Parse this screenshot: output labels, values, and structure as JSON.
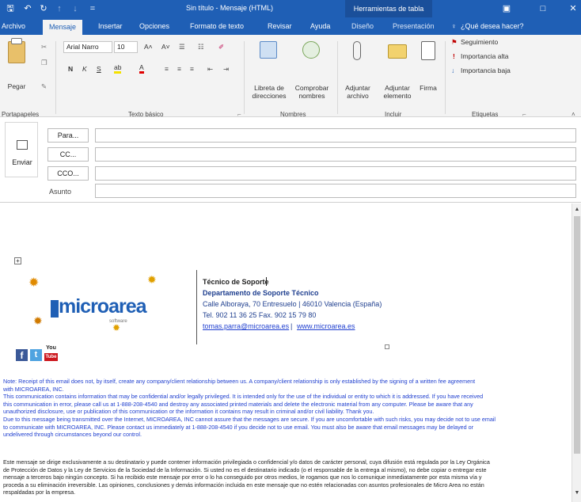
{
  "window": {
    "title": "Sin título - Mensaje (HTML)",
    "tools_context": "Herramientas de tabla",
    "quick_access": {
      "save": "🖫",
      "undo": "↶",
      "redo": "↻",
      "up": "↑",
      "down": "↓",
      "more": "="
    },
    "controls": {
      "ribbon_options": "▣",
      "restore": "□",
      "close": "✕"
    }
  },
  "tabs": [
    "Archivo",
    "Mensaje",
    "Insertar",
    "Opciones",
    "Formato de texto",
    "Revisar",
    "Ayuda",
    "Diseño",
    "Presentación"
  ],
  "tell_me": "¿Qué desea hacer?",
  "ribbon": {
    "clipboard": {
      "paste": "Pegar",
      "label": "Portapapeles"
    },
    "basic_text": {
      "font": "Arial Narro",
      "size": "10",
      "bold": "N",
      "italic": "K",
      "underline": "S",
      "label": "Texto básico"
    },
    "names": {
      "address_book_1": "Libreta de",
      "address_book_2": "direcciones",
      "check_1": "Comprobar",
      "check_2": "nombres",
      "label": "Nombres"
    },
    "include": {
      "attach_file_1": "Adjuntar",
      "attach_file_2": "archivo",
      "attach_item_1": "Adjuntar",
      "attach_item_2": "elemento",
      "signature": "Firma",
      "label": "Incluir"
    },
    "tags": {
      "follow_up": "Seguimiento",
      "high": "Importancia alta",
      "low": "Importancia baja",
      "label": "Etiquetas"
    }
  },
  "compose": {
    "send": "Enviar",
    "to": "Para...",
    "cc": "CC...",
    "bcc": "CCO...",
    "subject": "Asunto"
  },
  "signature": {
    "logo_text": "microarea",
    "logo_sub": "software",
    "title": "Técnico de Soporte",
    "department": "Departamento de Soporte Técnico",
    "address": "Calle Alboraya, 70 Entresuelo | 46010 Valencia (España)",
    "phone": "Tel. 902 11 36 25 Fax. 902 15 79 80",
    "email": "tomas.parra@microarea.es",
    "separator": "|",
    "web": "www.microarea.es",
    "social": {
      "facebook": "f",
      "twitter": "t",
      "youtube_top": "You",
      "youtube_bottom": "Tube"
    }
  },
  "disclaimer_en": [
    "Note: Receipt of this email does not, by itself, create any company/client relationship between us.  A company/client relationship is only established by the signing of a written fee agreement",
    "with MICROAREA, INC.",
    "This communication contains information that may be confidential and/or legally privileged. It is intended only for the use of the individual or entity to which it is addressed. If you have received",
    "this communication in error, please call us at 1-888-208-4540 and destroy any associated printed materials and delete the electronic material from any computer. Please be aware that any",
    "unauthorized disclosure, use or publication of this communication or the information it contains may result in criminal and/or civil liability. Thank you.",
    "Due to this message being transmitted over the Internet, MICROAREA, INC cannot assure that the messages are secure.  If you are uncomfortable with such risks, you may decide not to use email",
    "to communicate with MICROAREA, INC.  Please contact us immediately at 1-888-208-4540  if you decide not to use email.  You must also be aware that email messages may be delayed or",
    "undelivered through circumstances beyond our control."
  ],
  "disclaimer_es": [
    "Este mensaje se dirige exclusivamente a su destinatario y puede contener información privilegiada o confidencial y/o datos de carácter personal, cuya difusión está regulada por la Ley Orgánica",
    "de Protección de Datos y la Ley de Servicios de la Sociedad de la Información. Si usted no es el destinatario indicado (o el responsable de la entrega al mismo), no debe copiar o entregar este",
    "mensaje a terceros bajo ningún concepto. Si ha recibido este mensaje por error o lo ha conseguido por otros medios, le rogamos que nos lo comunique inmediatamente por esta misma vía y",
    "proceda a su eliminación irreversible. Las opiniones, conclusiones y demás información incluida en este mensaje que no estén relacionadas con asuntos profesionales de Micro Area  no están",
    "respaldadas por la empresa."
  ],
  "colors": {
    "accent": "#1f5fb5",
    "link": "#1f3fcf",
    "signature": "#1f3f8f"
  }
}
